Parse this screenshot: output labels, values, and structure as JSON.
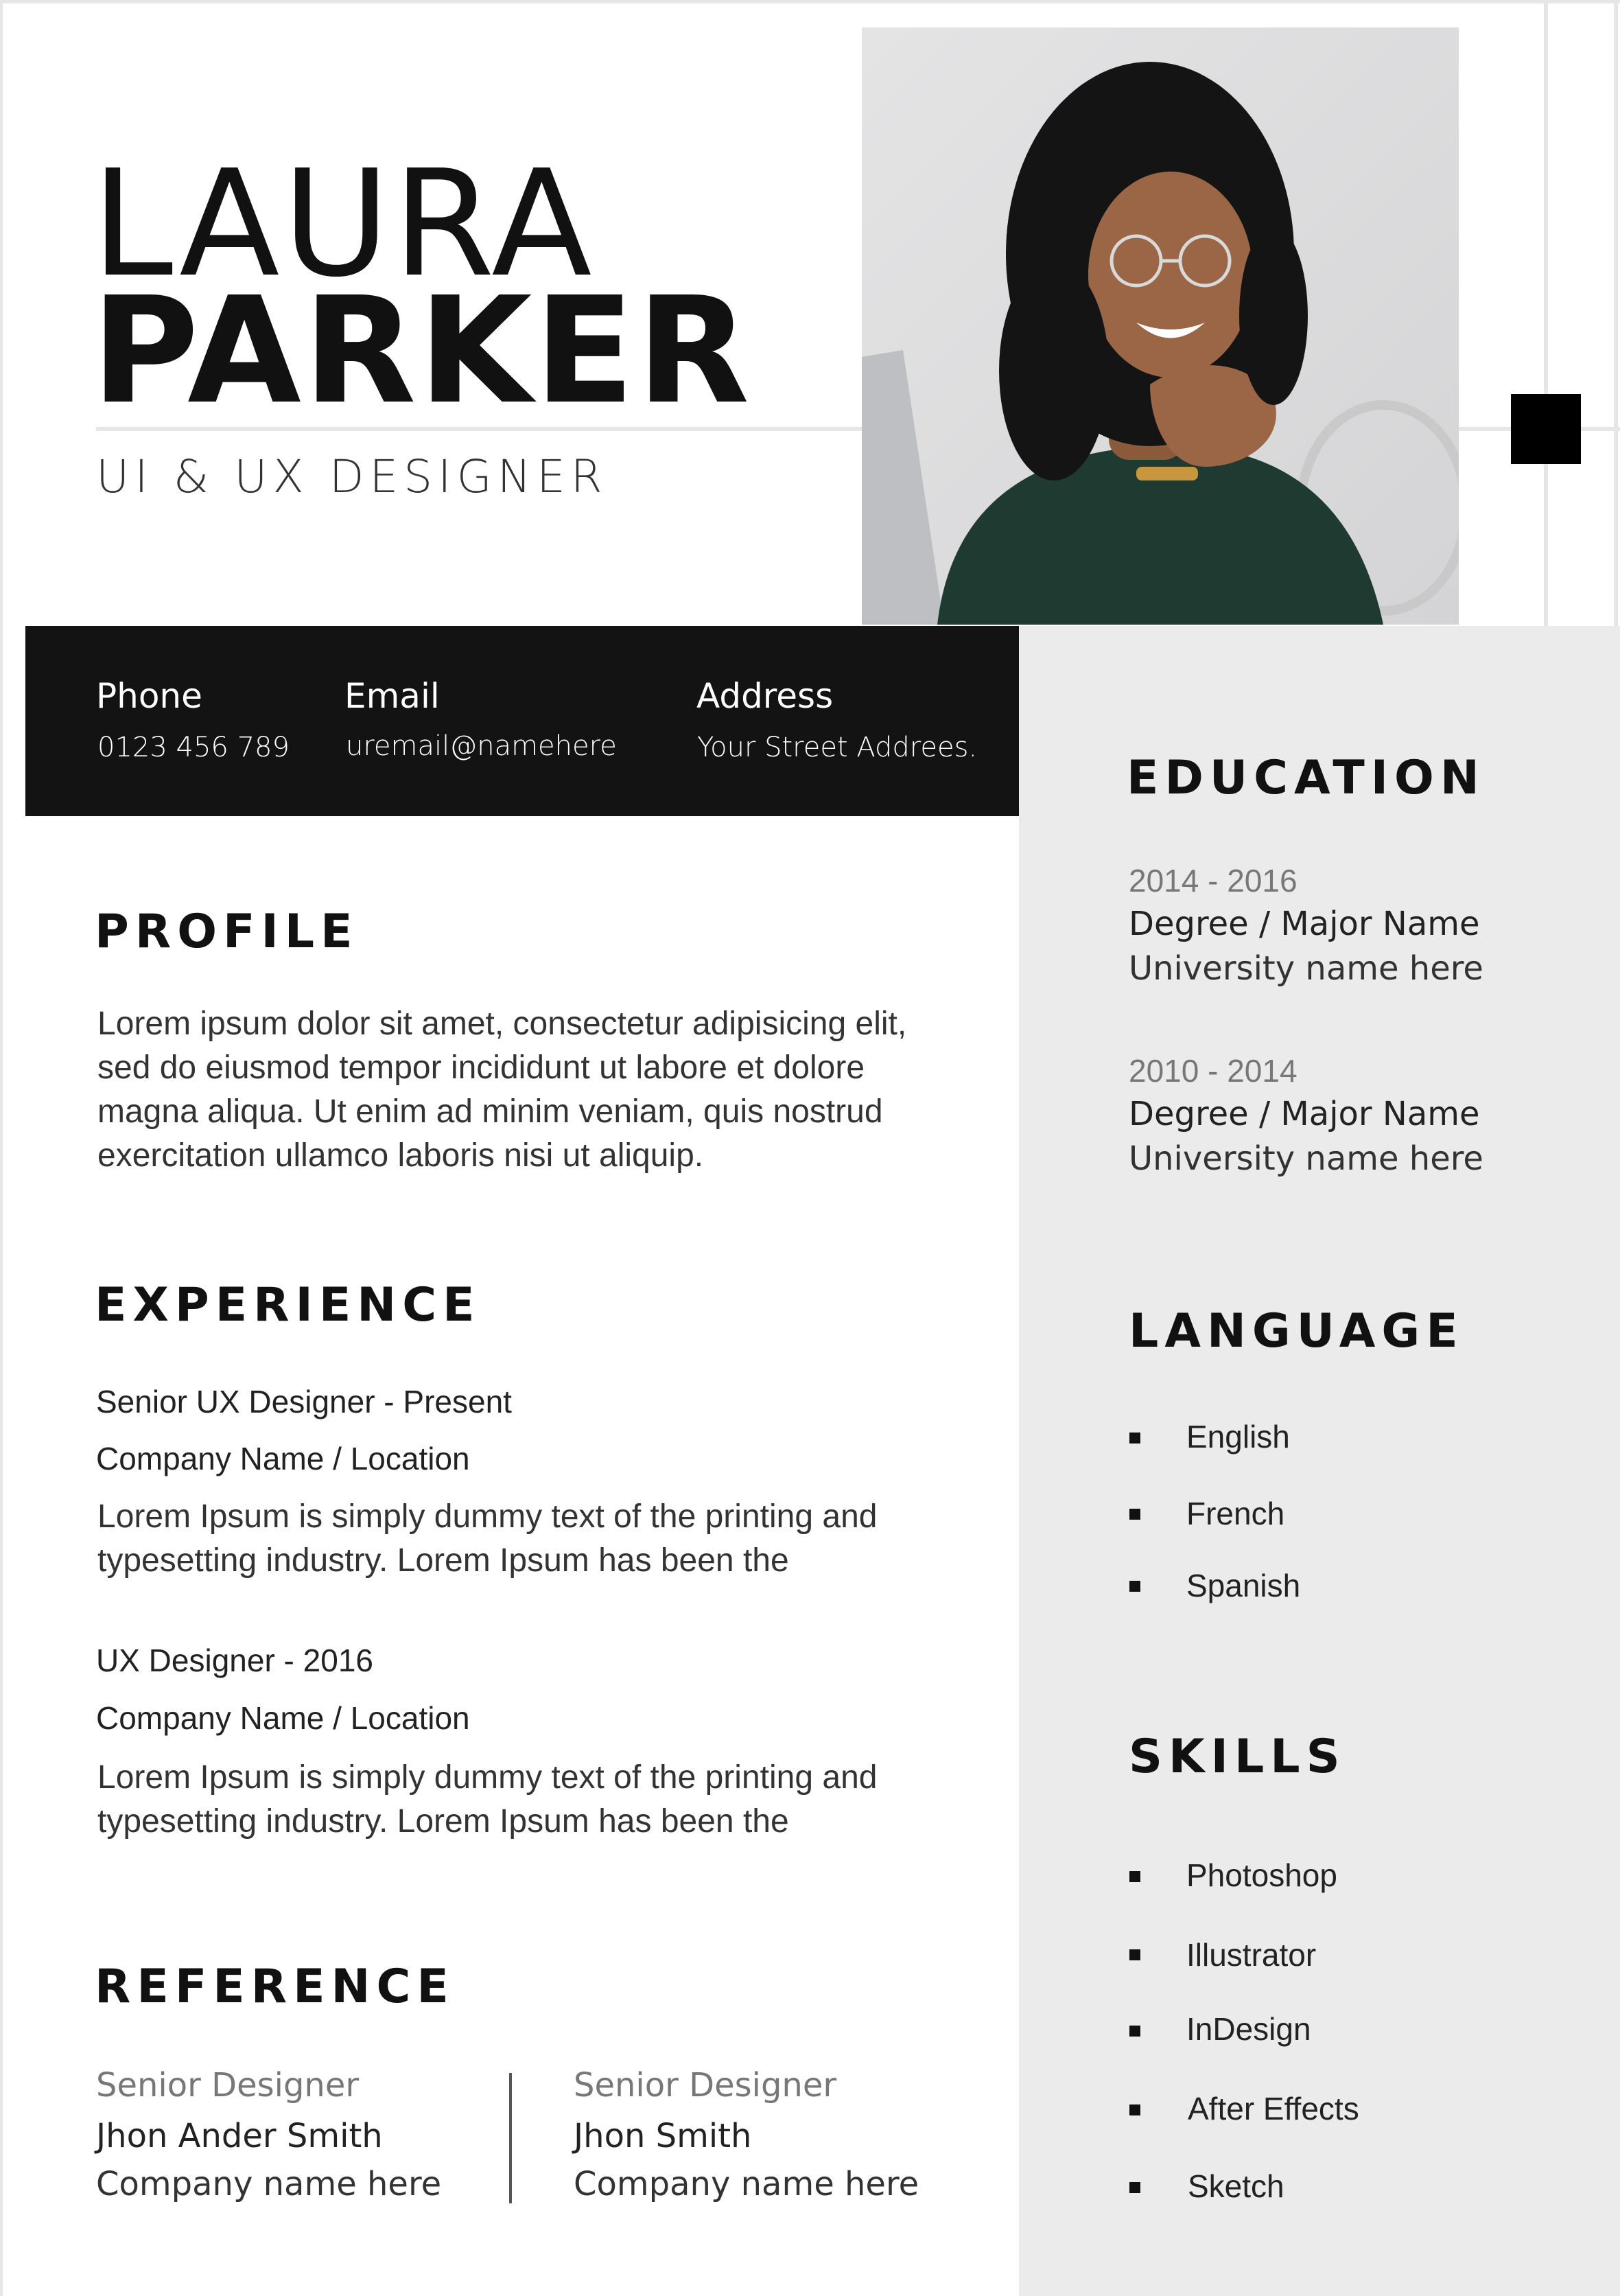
{
  "header": {
    "first_name": "LAURA",
    "last_name": "PARKER",
    "job_title": "UI & UX DESIGNER"
  },
  "photo": {
    "icon": "portrait-photo"
  },
  "contact": {
    "phone_label": "Phone",
    "phone_value": "0123 456 789",
    "email_label": "Email",
    "email_value": "uremail@namehere",
    "address_label": "Address",
    "address_value": "Your Street Addrees."
  },
  "profile": {
    "heading": "PROFILE",
    "lines": [
      "Lorem ipsum dolor sit amet, consectetur adipisicing elit,",
      "sed do eiusmod tempor incididunt ut labore et dolore",
      "magna aliqua. Ut enim ad minim veniam, quis nostrud",
      "exercitation ullamco laboris nisi ut aliquip."
    ]
  },
  "experience": {
    "heading": "EXPERIENCE",
    "items": [
      {
        "title": "Senior UX Designer - Present",
        "company": "Company Name / Location",
        "lines": [
          "Lorem Ipsum is simply dummy text of the printing and",
          "typesetting industry. Lorem Ipsum has been the"
        ]
      },
      {
        "title": "UX Designer - 2016",
        "company": "Company Name / Location",
        "lines": [
          "Lorem Ipsum is simply dummy text of the printing and",
          "typesetting industry. Lorem Ipsum has been the"
        ]
      }
    ]
  },
  "reference": {
    "heading": "REFERENCE",
    "items": [
      {
        "role": "Senior Designer",
        "name": "Jhon Ander Smith",
        "company": "Company name here"
      },
      {
        "role": "Senior Designer",
        "name": "Jhon Smith",
        "company": "Company name here"
      }
    ]
  },
  "education": {
    "heading": "EDUCATION",
    "items": [
      {
        "years": "2014 - 2016",
        "degree": "Degree / Major Name",
        "university": "University name here"
      },
      {
        "years": "2010 - 2014",
        "degree": "Degree / Major Name",
        "university": "University name here"
      }
    ]
  },
  "language": {
    "heading": "LANGUAGE",
    "items": [
      "English",
      "French",
      "Spanish"
    ]
  },
  "skills": {
    "heading": "SKILLS",
    "items": [
      "Photoshop",
      "Illustrator",
      "InDesign",
      "After Effects",
      "Sketch"
    ]
  },
  "colors": {
    "dark": "#131313",
    "sidebar_gray": "#ebebeb",
    "muted_text": "#777777"
  }
}
